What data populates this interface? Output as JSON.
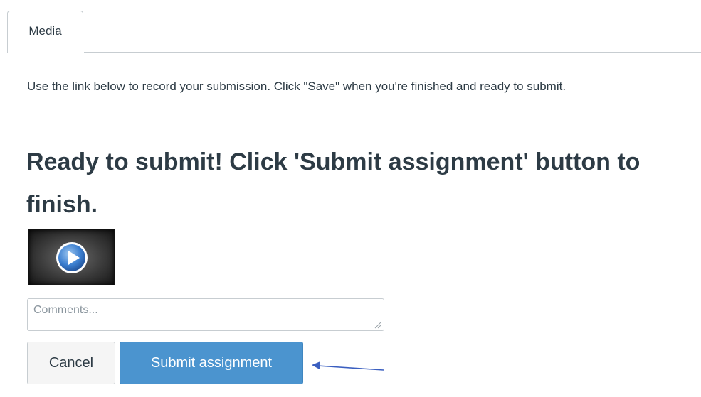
{
  "tabs": [
    {
      "label": "Media",
      "active": true
    }
  ],
  "instructions": "Use the link below to record your submission. Click \"Save\" when you're finished and ready to submit.",
  "status_heading": "Ready to submit! Click 'Submit assignment' button to finish.",
  "media": {
    "thumbnail_icon": "play-icon"
  },
  "comments": {
    "placeholder": "Comments...",
    "value": ""
  },
  "buttons": {
    "cancel_label": "Cancel",
    "submit_label": "Submit assignment"
  },
  "colors": {
    "text": "#2d3b45",
    "border": "#c7cdd1",
    "primary_button": "#4b94cf",
    "annotation_arrow": "#3b5fc0"
  }
}
